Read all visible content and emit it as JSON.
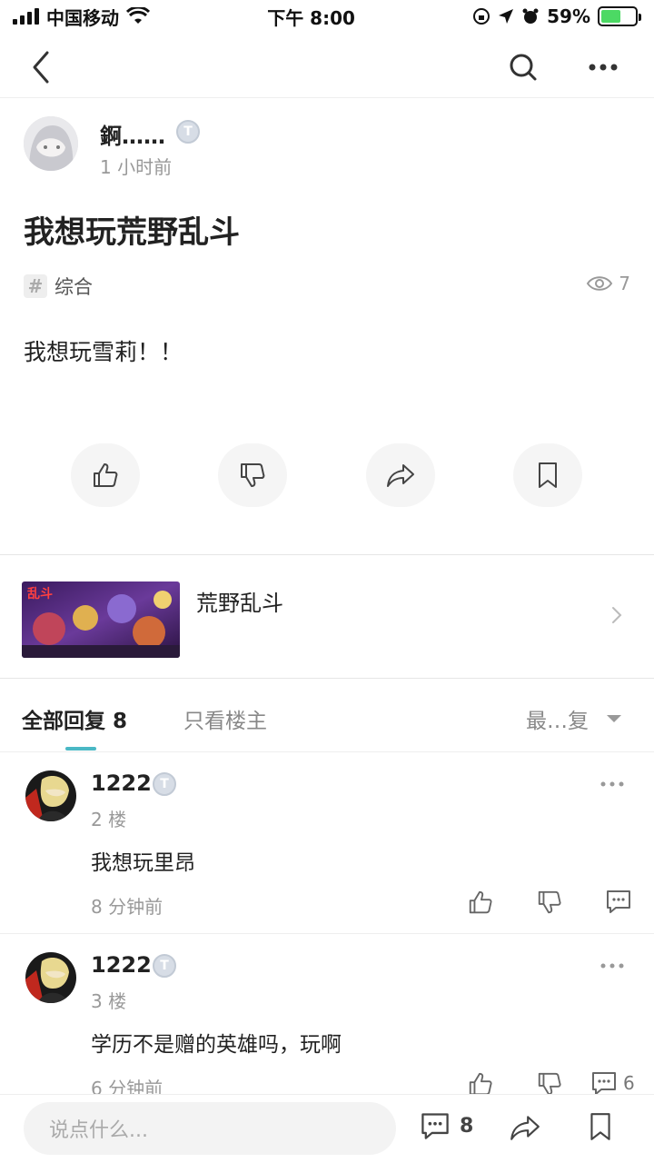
{
  "status_bar": {
    "carrier": "中国移动",
    "time": "下午 8:00",
    "battery": "59%",
    "battery_level": 0.59
  },
  "post": {
    "author_name": "錒……",
    "time": "1 小时前",
    "title": "我想玩荒野乱斗",
    "tag": "综合",
    "views": "7",
    "body": "我想玩雪莉！！"
  },
  "game_card": {
    "name": "荒野乱斗",
    "thumb_text": "乱斗"
  },
  "reply_tabs": {
    "all_label": "全部回复",
    "all_count": "8",
    "op_only": "只看楼主",
    "sort": "最…复"
  },
  "comments": [
    {
      "name": "1222",
      "floor": "2 楼",
      "text": "我想玩里昂",
      "time": "8 分钟前",
      "reply_count": ""
    },
    {
      "name": "1222",
      "floor": "3 楼",
      "text": "学历不是赠的英雄吗，玩啊",
      "time": "6 分钟前",
      "reply_count": "6"
    }
  ],
  "bottom_bar": {
    "input_placeholder": "说点什么...",
    "comment_count": "8"
  },
  "colors": {
    "accent": "#4ab8c5",
    "battery_green": "#4cd964"
  },
  "icons": [
    "back-icon",
    "search-icon",
    "more-icon",
    "hash-icon",
    "eye-icon",
    "thumbs-up-icon",
    "thumbs-down-icon",
    "share-icon",
    "bookmark-icon",
    "chevron-right-icon",
    "comment-icon"
  ]
}
